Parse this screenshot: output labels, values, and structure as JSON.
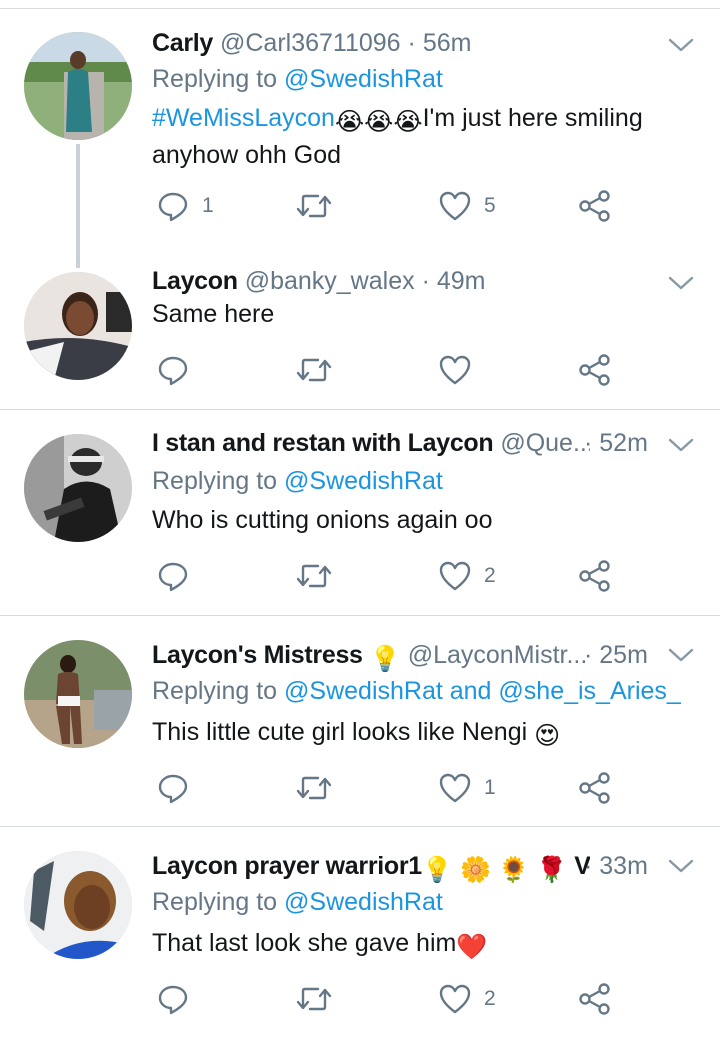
{
  "tweets": [
    {
      "name": "Carly",
      "handle": "@Carl36711096",
      "dot": "·",
      "time": "56m",
      "reply_prefix": "Replying to",
      "reply_to": "@SwedishRat",
      "hashtag": "#WeMissLaycon",
      "body_emojis": [
        "😭",
        "😭",
        "😭"
      ],
      "body": "I'm just here smiling anyhow ohh God",
      "replies": "1",
      "retweets": "",
      "likes": "5"
    },
    {
      "name": "Laycon",
      "handle": "@banky_walex",
      "dot": "·",
      "time": "49m",
      "body": "Same here",
      "replies": "",
      "retweets": "",
      "likes": ""
    },
    {
      "name": "I stan and restan with Laycon",
      "handle": "@Que...",
      "dot": "·",
      "time": "52m",
      "reply_prefix": "Replying to",
      "reply_to": "@SwedishRat",
      "body": "Who is cutting onions again oo",
      "replies": "",
      "retweets": "",
      "likes": "2"
    },
    {
      "name": "Laycon's Mistress",
      "name_emoji": "💡",
      "handle": "@LayconMistr...",
      "dot": "·",
      "time": "25m",
      "reply_prefix": "Replying to",
      "reply_to": "@SwedishRat and @she_is_Aries_",
      "body": "This little cute girl looks like Nengi",
      "body_emoji": "😍",
      "replies": "",
      "retweets": "",
      "likes": "1"
    },
    {
      "name": "Laycon prayer warrior1",
      "name_emojis": [
        "💡",
        "🌼",
        "🌻",
        "🌹"
      ],
      "name_suffix": "Vi...",
      "dot": "·",
      "time": "33m",
      "reply_prefix": "Replying to",
      "reply_to": "@SwedishRat",
      "body": "That last look she gave him",
      "body_emoji": "❤️",
      "replies": "",
      "retweets": "",
      "likes": "2"
    }
  ],
  "icons": {
    "reply": "reply-icon",
    "retweet": "retweet-icon",
    "like": "heart-icon",
    "share": "share-icon",
    "caret": "chevron-down-icon"
  },
  "colors": {
    "link": "#1b95e0",
    "muted": "#657786",
    "text": "#14171a",
    "divider": "#d6dbdf"
  }
}
